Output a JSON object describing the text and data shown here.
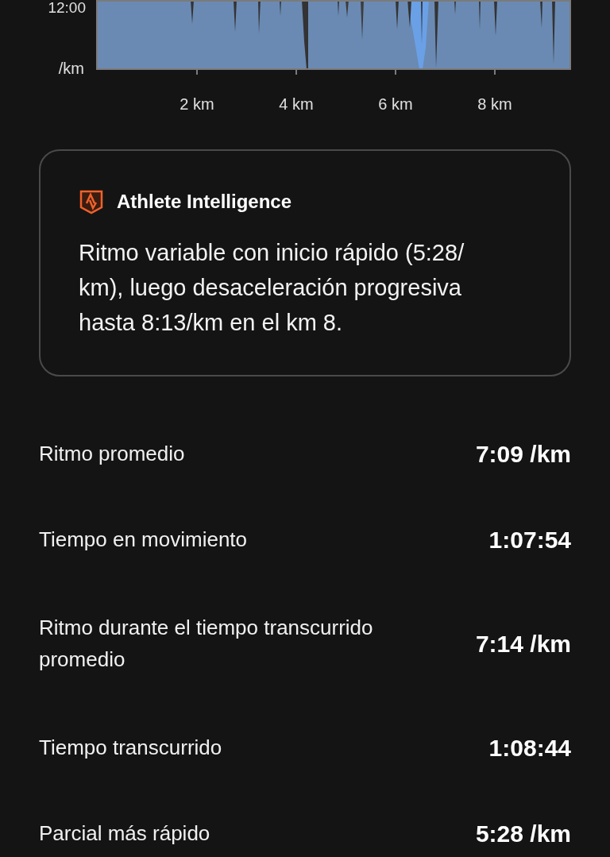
{
  "chart": {
    "y_labels": [
      "12:00",
      "/km"
    ],
    "x_labels": [
      "2 km",
      "4 km",
      "6 km",
      "8 km"
    ]
  },
  "insight": {
    "title": "Athlete Intelligence",
    "text": "Ritmo variable con inicio rápido (5:28/ km), luego desaceleración progresiva hasta 8:13/km en el km 8."
  },
  "stats": [
    {
      "label": "Ritmo promedio",
      "value": "7:09 /km"
    },
    {
      "label": "Tiempo en movimiento",
      "value": "1:07:54"
    },
    {
      "label": "Ritmo durante el tiempo transcurrido promedio",
      "value": "7:14 /km"
    },
    {
      "label": "Tiempo transcurrido",
      "value": "1:08:44"
    },
    {
      "label": "Parcial más rápido",
      "value": "5:28 /km"
    }
  ]
}
